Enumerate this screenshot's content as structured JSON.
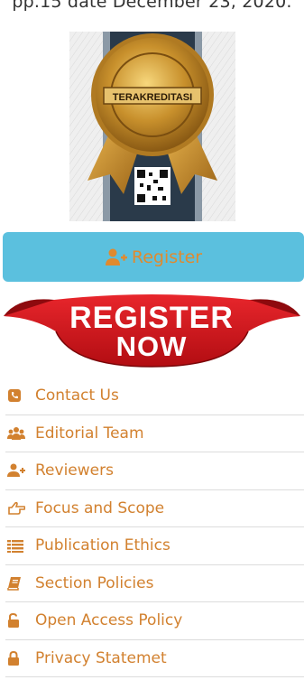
{
  "top_text": "pp.15 date December 23, 2020.",
  "badge": {
    "seal_text": "TERAKREDITASI"
  },
  "register_button": {
    "icon": "user-plus-icon",
    "label": "Register"
  },
  "register_now_banner": {
    "line1": "REGISTER",
    "line2": "NOW"
  },
  "colors": {
    "accent": "#d2812f",
    "button_bg": "#5bc0de",
    "banner_red": "#d6131c"
  },
  "menu": [
    {
      "icon": "phone-square-icon",
      "label": "Contact Us"
    },
    {
      "icon": "users-icon",
      "label": "Editorial Team"
    },
    {
      "icon": "user-plus-icon",
      "label": "Reviewers"
    },
    {
      "icon": "hand-point-icon",
      "label": "Focus and Scope"
    },
    {
      "icon": "list-icon",
      "label": "Publication Ethics"
    },
    {
      "icon": "book-icon",
      "label": "Section Policies"
    },
    {
      "icon": "unlock-icon",
      "label": "Open Access Policy"
    },
    {
      "icon": "lock-icon",
      "label": "Privacy Statemet"
    }
  ]
}
